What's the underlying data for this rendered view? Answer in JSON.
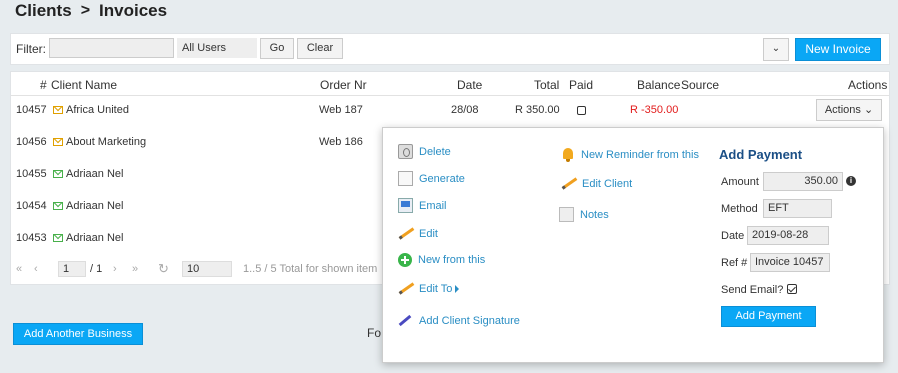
{
  "breadcrumb": {
    "root": "Clients",
    "separator": ">",
    "current": "Invoices"
  },
  "filter": {
    "label": "Filter:",
    "input_value": "",
    "users_select": "All Users",
    "go_label": "Go",
    "clear_label": "Clear",
    "new_invoice_label": "New Invoice"
  },
  "table": {
    "headers": {
      "num": "#",
      "client": "Client Name",
      "order": "Order Nr",
      "date": "Date",
      "total": "Total",
      "paid": "Paid",
      "balance": "Balance",
      "source": "Source",
      "actions": "Actions"
    },
    "rows": [
      {
        "num": "10457",
        "client": "Africa United",
        "order": "Web 187",
        "date": "28/08",
        "total": "R 350.00",
        "balance": "R -350.00",
        "actions": "Actions"
      },
      {
        "num": "10456",
        "client": "About Marketing",
        "order": "Web 186"
      },
      {
        "num": "10455",
        "client": "Adriaan Nel"
      },
      {
        "num": "10454",
        "client": "Adriaan Nel"
      },
      {
        "num": "10453",
        "client": "Adriaan Nel"
      }
    ]
  },
  "pager": {
    "page": "1",
    "of": "/ 1",
    "page_size": "10",
    "summary": "1..5 / 5  Total for shown item"
  },
  "add_business_label": "Add Another Business",
  "footer_fragment": "Fo",
  "menu": {
    "delete": "Delete",
    "generate": "Generate",
    "email": "Email",
    "edit": "Edit",
    "new_from_this": "New from this",
    "edit_to": "Edit To",
    "add_client_signature": "Add Client Signature",
    "new_reminder": "New Reminder from this",
    "edit_client": "Edit Client",
    "notes": "Notes"
  },
  "payment": {
    "title": "Add Payment",
    "amount_label": "Amount",
    "amount_value": "350.00",
    "method_label": "Method",
    "method_value": "EFT",
    "date_label": "Date",
    "date_value": "2019-08-28",
    "ref_label": "Ref #",
    "ref_value": "Invoice 10457",
    "send_email_label": "Send Email?",
    "send_email_checked": true,
    "button_label": "Add Payment"
  },
  "colors": {
    "primary": "#0aa7f5",
    "link": "#2a8ec4",
    "negative": "#e21b1b",
    "heading": "#1b4f86"
  }
}
